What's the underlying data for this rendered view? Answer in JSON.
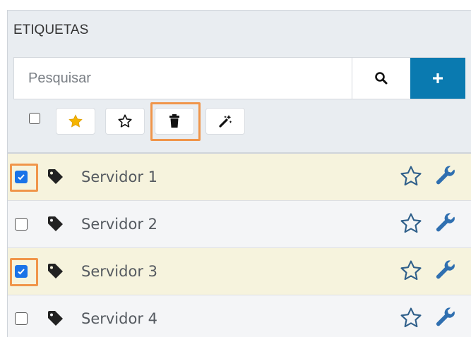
{
  "panel": {
    "title": "ETIQUETAS"
  },
  "search": {
    "placeholder": "Pesquisar"
  },
  "toolbar": {
    "buttons": [
      {
        "name": "favorite-filled",
        "icon": "star-filled-icon",
        "color": "#f5b400"
      },
      {
        "name": "favorite-outline",
        "icon": "star-outline-icon"
      },
      {
        "name": "delete",
        "icon": "trash-icon",
        "highlighted": true
      },
      {
        "name": "magic",
        "icon": "magic-wand-icon"
      }
    ]
  },
  "tags": [
    {
      "label": "Servidor 1",
      "checked": true
    },
    {
      "label": "Servidor 2",
      "checked": false
    },
    {
      "label": "Servidor 3",
      "checked": true
    },
    {
      "label": "Servidor 4",
      "checked": false
    }
  ],
  "colors": {
    "accent": "#0a7ab0",
    "highlight": "#f0954a",
    "wrench": "#2f6fb0",
    "star_outline": "#2f5f8a",
    "selected_row": "#f6f3dd"
  }
}
